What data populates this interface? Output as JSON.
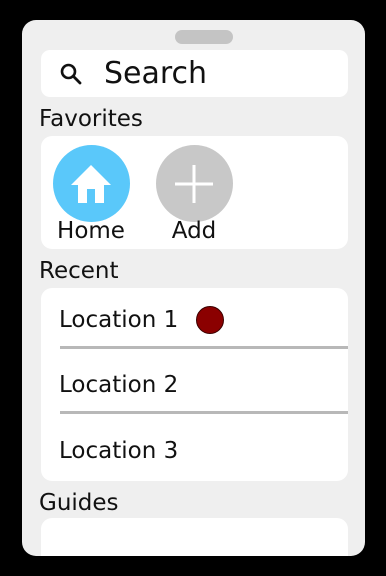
{
  "search": {
    "label": "Search",
    "icon": "search-icon"
  },
  "sections": {
    "favorites": "Favorites",
    "recent": "Recent",
    "guides": "Guides"
  },
  "favorites": [
    {
      "label": "Home",
      "icon": "home-icon",
      "color": "#5ac8fa"
    },
    {
      "label": "Add",
      "icon": "plus-icon",
      "color": "#c8c8c8"
    }
  ],
  "recent": [
    {
      "label": "Location 1",
      "indicator_color": "#8b0000"
    },
    {
      "label": "Location 2"
    },
    {
      "label": "Location 3"
    }
  ]
}
